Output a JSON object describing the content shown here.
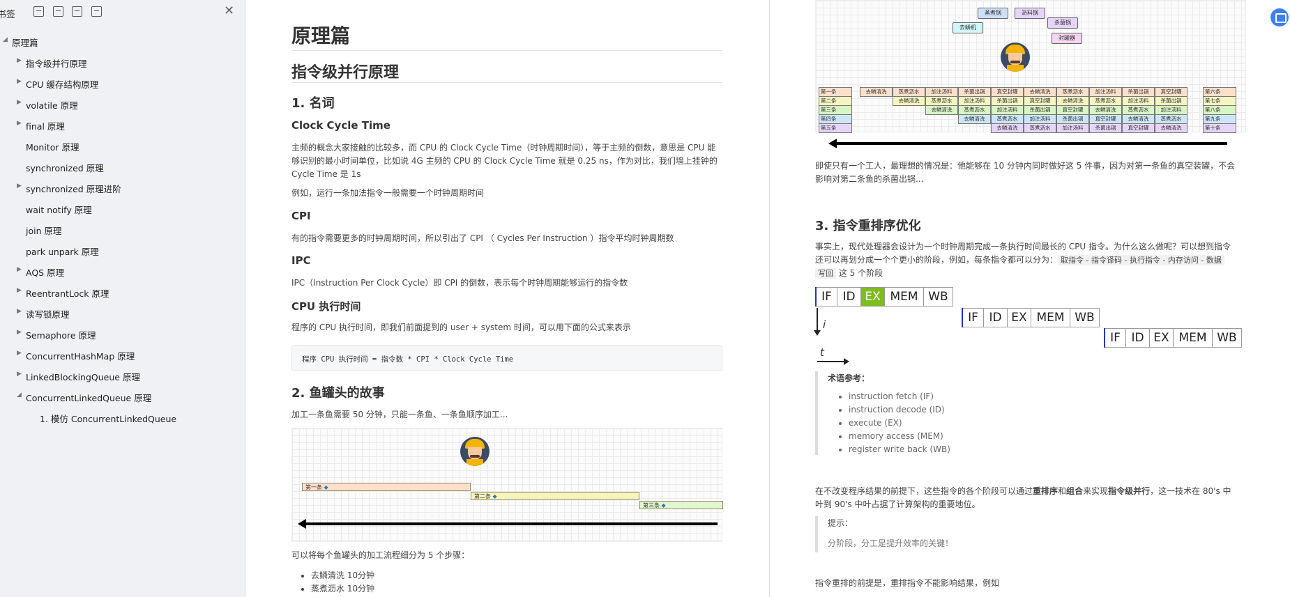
{
  "sidebar": {
    "title": "书签",
    "close": "✕",
    "tree": [
      {
        "label": "原理篇",
        "level": 0,
        "expanded": true
      },
      {
        "label": "指令级并行原理",
        "level": 1,
        "expanded": false
      },
      {
        "label": "CPU 缓存结构原理",
        "level": 1,
        "expanded": false
      },
      {
        "label": "volatile 原理",
        "level": 1,
        "expanded": false
      },
      {
        "label": "final 原理",
        "level": 1,
        "expanded": false
      },
      {
        "label": "Monitor 原理",
        "level": 1,
        "leaf": true
      },
      {
        "label": "synchronized 原理",
        "level": 1,
        "leaf": true
      },
      {
        "label": "synchronized 原理进阶",
        "level": 1,
        "expanded": false
      },
      {
        "label": "wait notify 原理",
        "level": 1,
        "leaf": true
      },
      {
        "label": "join 原理",
        "level": 1,
        "leaf": true
      },
      {
        "label": "park unpark 原理",
        "level": 1,
        "leaf": true
      },
      {
        "label": "AQS 原理",
        "level": 1,
        "expanded": false
      },
      {
        "label": "ReentrantLock 原理",
        "level": 1,
        "expanded": false
      },
      {
        "label": "读写锁原理",
        "level": 1,
        "expanded": false
      },
      {
        "label": "Semaphore 原理",
        "level": 1,
        "expanded": false
      },
      {
        "label": "ConcurrentHashMap 原理",
        "level": 1,
        "expanded": false
      },
      {
        "label": "LinkedBlockingQueue 原理",
        "level": 1,
        "expanded": false
      },
      {
        "label": "ConcurrentLinkedQueue 原理",
        "level": 1,
        "expanded": true
      },
      {
        "label": "1. 模仿 ConcurrentLinkedQueue",
        "level": 2,
        "leaf": true
      }
    ]
  },
  "page1": {
    "h1": "原理篇",
    "h2": "指令级并行原理",
    "s1": "1. 名词",
    "clock_title": "Clock Cycle Time",
    "clock_p1": "主频的概念大家接触的比较多，而 CPU 的 Clock Cycle Time（时钟周期时间），等于主频的倒数，意思是 CPU 能",
    "clock_p2": "够识别的最小时间单位，比如说 4G 主频的 CPU 的 Clock Cycle Time 就是 0.25 ns，作为对比，我们墙上挂钟的",
    "clock_p3": "Cycle Time 是 1s",
    "clock_p4": "例如，运行一条加法指令一般需要一个时钟周期时间",
    "cpi_title": "CPI",
    "cpi_p": "有的指令需要更多的时钟周期时间，所以引出了 CPI （ Cycles Per Instruction ）指令平均时钟周期数",
    "ipc_title": "IPC",
    "ipc_p": "IPC（Instruction Per Clock Cycle）即 CPI 的倒数，表示每个时钟周期能够运行的指令数",
    "exec_title": "CPU 执行时间",
    "exec_p": "程序的 CPU 执行时间，即我们前面提到的 user + system 时间，可以用下面的公式来表示",
    "code": "程序 CPU 执行时间 = 指令数 * CPI * Clock Cycle Time",
    "s2": "2. 鱼罐头的故事",
    "fish_p": "加工一条鱼需要 50 分钟，只能一条鱼、一条鱼顺序加工...",
    "fish_labels": [
      "第一条",
      "第二条",
      "第三条"
    ],
    "steps_intro": "可以将每个鱼罐头的加工流程细分为 5 个步骤：",
    "steps": [
      "去鳞清洗 10分钟",
      "蒸煮沥水 10分钟"
    ]
  },
  "page2": {
    "tools": [
      "蒸煮锅",
      "沥料锅",
      "去鳞机",
      "杀菌锅",
      "封罐器"
    ],
    "fish_left": [
      "第一条",
      "第二条",
      "第三条",
      "第四条",
      "第五条"
    ],
    "fish_right": [
      "第六条",
      "第七条",
      "第八条",
      "第九条",
      "第十条"
    ],
    "steps": [
      "去鳞清洗",
      "蒸煮沥水",
      "加注汤料",
      "杀菌出锅",
      "真空封罐"
    ],
    "p_worker1": "即使只有一个工人，最理想的情况是：他能够在 10 分钟内同时做好这 5 件事，因为对第一条鱼的真空装罐，不会",
    "p_worker2": "影响对第二条鱼的杀菌出锅...",
    "s3": "3. 指令重排序优化",
    "p3_1a": "事实上，现代处理器会设计为一个时钟周期完成一条执行时间最长的 CPU 指令。为什么这么做呢？可以想到指令",
    "p3_2a": "还可以再划分成一个个更小的阶段，例如，每条指令都可以分为：",
    "p3_inline": "取指令 - 指令译码 - 执行指令 - 内存访问 - 数据",
    "p3_3a": "写回",
    "p3_3b": "这 5 个阶段",
    "pipeline": [
      "IF",
      "ID",
      "EX",
      "MEM",
      "WB"
    ],
    "axis_i": "i",
    "axis_t": "t",
    "terms_title": "术语参考：",
    "terms": [
      "instruction fetch (IF)",
      "instruction decode (ID)",
      "execute (EX)",
      "memory access (MEM)",
      "register write back (WB)"
    ],
    "p4_a": "在不改变程序结果的前提下，这些指令的各个阶段可以通过",
    "p4_b1": "重排序",
    "p4_and": "和",
    "p4_b2": "组合",
    "p4_c": "来实现",
    "p4_b3": "指令级并行",
    "p4_d": "，这一技术在 80's 中",
    "p4_2": "叶到 90's 中叶占据了计算架构的重要地位。",
    "tip_title": "提示：",
    "tip_text": "分阶段，分工是提升效率的关键！",
    "p5": "指令重排的前提是，重排指令不能影响结果，例如"
  },
  "colors": {
    "ex_highlight": "#7dbd1e",
    "step_colors": [
      "#fce0cc",
      "#f5f5c0",
      "#d8f5c4",
      "#cde6f7",
      "#e6d5f7"
    ],
    "tool_colors": [
      "#cde0f7",
      "#e6d5f7",
      "#d2f5f7",
      "#e6d5f7",
      "#f5d5f0"
    ],
    "fab": "#3d7ff5"
  }
}
